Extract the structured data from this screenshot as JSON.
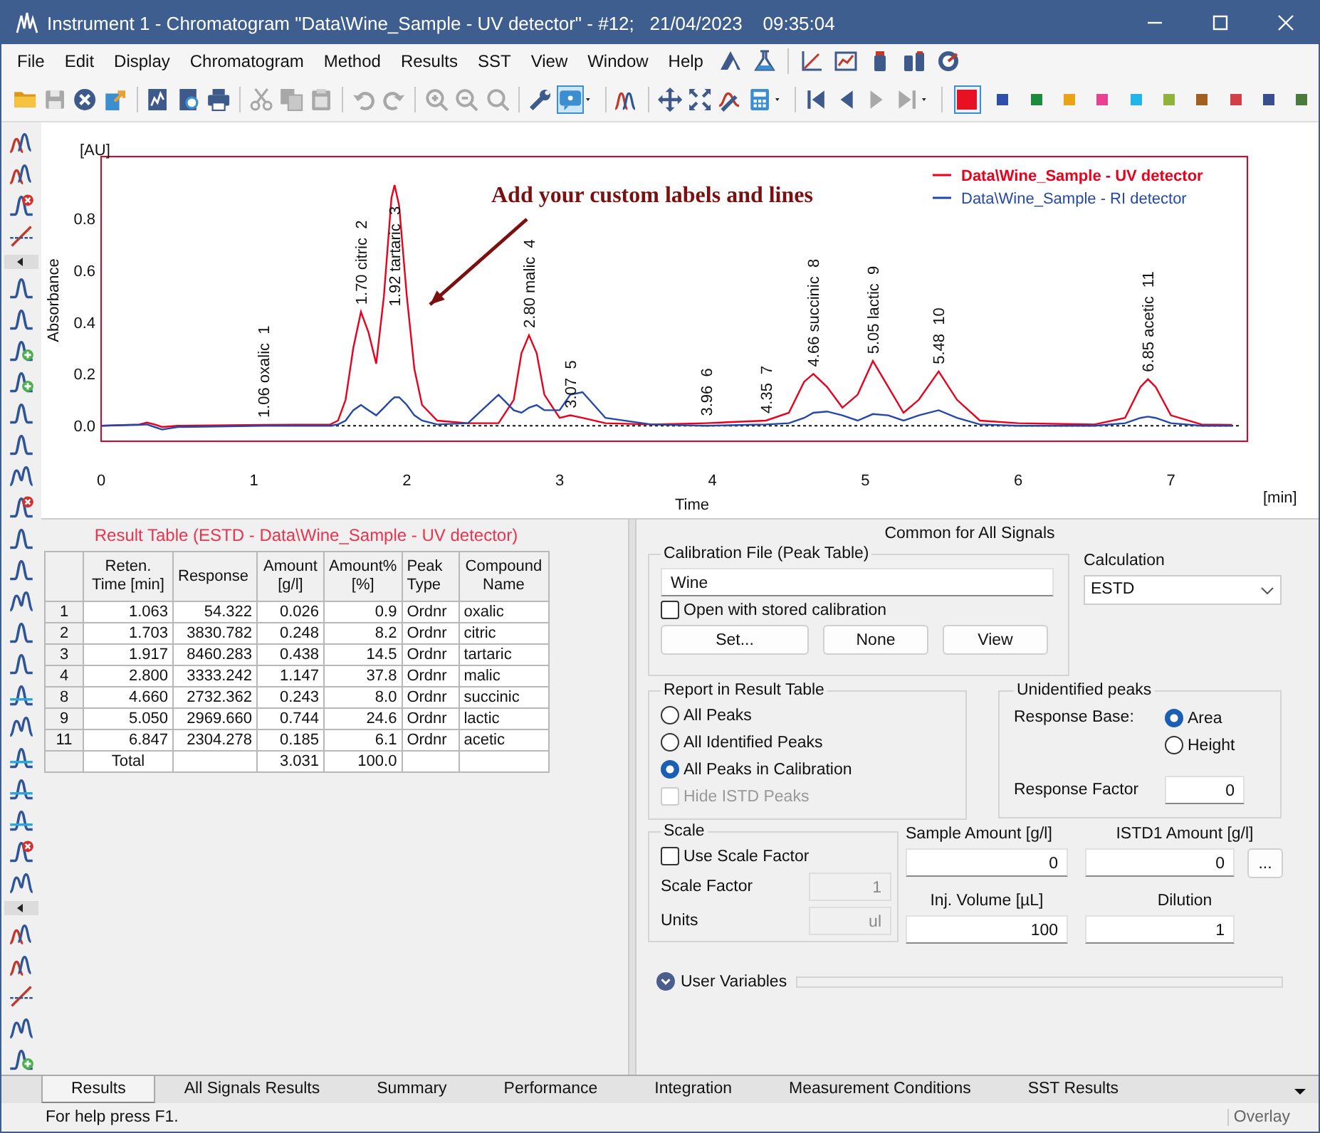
{
  "window": {
    "title": "Instrument 1 - Chromatogram \"Data\\Wine_Sample - UV detector\" - #12;   21/04/2023    09:35:04"
  },
  "menu": [
    "File",
    "Edit",
    "Display",
    "Chromatogram",
    "Method",
    "Results",
    "SST",
    "View",
    "Window",
    "Help"
  ],
  "toolbar": {
    "colors": [
      {
        "color": "#e81123",
        "selected": true
      },
      {
        "color": "#2f4fa8",
        "selected": false
      },
      {
        "color": "#1e8a3c",
        "selected": false
      },
      {
        "color": "#e8a317",
        "selected": false
      },
      {
        "color": "#e84393",
        "selected": false
      },
      {
        "color": "#22b5e8",
        "selected": false
      },
      {
        "color": "#8db33a",
        "selected": false
      },
      {
        "color": "#a0621e",
        "selected": false
      },
      {
        "color": "#d33f49",
        "selected": false
      },
      {
        "color": "#3b4f8c",
        "selected": false
      },
      {
        "color": "#4c7a3c",
        "selected": false
      }
    ]
  },
  "chart": {
    "x_unit": "[min]",
    "y_unit": "[AU]",
    "chart_data": {
      "type": "line",
      "xlabel": "Time",
      "ylabel": "Absorbance",
      "xlim": [
        0,
        7.5
      ],
      "ylim": [
        -0.06,
        1.04
      ],
      "legend": "upper right",
      "xticks": [
        0,
        1,
        2,
        3,
        4,
        5,
        6,
        7
      ],
      "yticks": [
        {
          "value": 0,
          "label": "0.0"
        },
        {
          "value": 0.2,
          "label": "0.2"
        },
        {
          "value": 0.4,
          "label": "0.4"
        },
        {
          "value": 0.6,
          "label": "0.6"
        },
        {
          "value": 0.8,
          "label": "0.8"
        }
      ],
      "x": [
        0,
        0.25,
        0.3,
        0.35,
        0.4,
        0.5,
        1.06,
        1.5,
        1.55,
        1.6,
        1.65,
        1.7,
        1.75,
        1.8,
        1.85,
        1.9,
        1.92,
        1.95,
        2.0,
        2.05,
        2.1,
        2.2,
        2.4,
        2.6,
        2.7,
        2.75,
        2.8,
        2.85,
        2.9,
        3.0,
        3.07,
        3.15,
        3.3,
        3.6,
        3.96,
        4.35,
        4.5,
        4.6,
        4.66,
        4.75,
        4.85,
        4.95,
        5.05,
        5.15,
        5.25,
        5.35,
        5.48,
        5.6,
        5.75,
        6.0,
        6.5,
        6.7,
        6.8,
        6.85,
        6.9,
        7.0,
        7.2,
        7.4
      ],
      "series": [
        {
          "name": "Data\\Wine_Sample - UV detector",
          "color": "#e8001c",
          "values": [
            0,
            0.005,
            0.012,
            0.005,
            -0.005,
            0,
            0.003,
            0.005,
            0.02,
            0.1,
            0.3,
            0.44,
            0.36,
            0.24,
            0.5,
            0.88,
            0.93,
            0.85,
            0.5,
            0.22,
            0.08,
            0.02,
            0.01,
            0.01,
            0.1,
            0.28,
            0.35,
            0.28,
            0.12,
            0.03,
            0.04,
            0.03,
            0.01,
            0.005,
            0.01,
            0.02,
            0.05,
            0.17,
            0.2,
            0.15,
            0.07,
            0.12,
            0.25,
            0.15,
            0.05,
            0.1,
            0.21,
            0.1,
            0.02,
            0.01,
            0.005,
            0.03,
            0.15,
            0.18,
            0.15,
            0.04,
            0.005,
            0.003
          ]
        },
        {
          "name": "Data\\Wine_Sample - RI detector",
          "color": "#2448a8",
          "values": [
            0,
            0.003,
            0.005,
            -0.005,
            -0.015,
            -0.005,
            0,
            0,
            0.005,
            0.02,
            0.06,
            0.08,
            0.06,
            0.04,
            0.07,
            0.1,
            0.11,
            0.11,
            0.08,
            0.04,
            0.02,
            0.005,
            0.01,
            0.12,
            0.06,
            0.05,
            0.07,
            0.08,
            0.06,
            0.06,
            0.12,
            0.13,
            0.03,
            0.005,
            0,
            0.005,
            0.01,
            0.03,
            0.05,
            0.055,
            0.04,
            0.02,
            0.045,
            0.04,
            0.02,
            0.04,
            0.06,
            0.03,
            0.005,
            0,
            0,
            0.01,
            0.03,
            0.035,
            0.03,
            0.01,
            0,
            0
          ]
        }
      ],
      "annotations": [
        {
          "x": 1.06,
          "y": 0.003,
          "text": "1.06 oxalic  1"
        },
        {
          "x": 1.7,
          "y": 0.44,
          "text": "1.70 citric  2"
        },
        {
          "x": 1.92,
          "y": 0.93,
          "text": "1.92 tartaric  3"
        },
        {
          "x": 2.8,
          "y": 0.35,
          "text": "2.80 malic  4"
        },
        {
          "x": 3.07,
          "y": 0.04,
          "text": "3.07  5"
        },
        {
          "x": 3.96,
          "y": 0.01,
          "text": "3.96  6"
        },
        {
          "x": 4.35,
          "y": 0.02,
          "text": "4.35  7"
        },
        {
          "x": 4.66,
          "y": 0.2,
          "text": "4.66 succinic  8"
        },
        {
          "x": 5.05,
          "y": 0.25,
          "text": "5.05 lactic  9"
        },
        {
          "x": 5.48,
          "y": 0.21,
          "text": "5.48  10"
        },
        {
          "x": 6.85,
          "y": 0.18,
          "text": "6.85 acetic  11"
        },
        "Add your custom labels and lines"
      ]
    }
  },
  "result_table": {
    "title": "Result Table (ESTD - Data\\Wine_Sample - UV detector)",
    "columns": [
      "",
      "Reten. Time [min]",
      "Response",
      "Amount [g/l]",
      "Amount% [%]",
      "Peak Type",
      "Compound Name"
    ],
    "rows": [
      [
        "1",
        "1.063",
        "54.322",
        "0.026",
        "0.9",
        "Ordnr",
        "oxalic"
      ],
      [
        "2",
        "1.703",
        "3830.782",
        "0.248",
        "8.2",
        "Ordnr",
        "citric"
      ],
      [
        "3",
        "1.917",
        "8460.283",
        "0.438",
        "14.5",
        "Ordnr",
        "tartaric"
      ],
      [
        "4",
        "2.800",
        "3333.242",
        "1.147",
        "37.8",
        "Ordnr",
        "malic"
      ],
      [
        "8",
        "4.660",
        "2732.362",
        "0.243",
        "8.0",
        "Ordnr",
        "succinic"
      ],
      [
        "9",
        "5.050",
        "2969.660",
        "0.744",
        "24.6",
        "Ordnr",
        "lactic"
      ],
      [
        "11",
        "6.847",
        "2304.278",
        "0.185",
        "6.1",
        "Ordnr",
        "acetic"
      ],
      [
        "",
        "Total",
        "",
        "3.031",
        "100.0",
        "",
        ""
      ]
    ]
  },
  "settings": {
    "heading": "Common for All Signals",
    "calibration": {
      "legend": "Calibration File (Peak Table)",
      "file": "Wine",
      "open_stored": {
        "label": "Open with stored calibration",
        "checked": false
      },
      "buttons": [
        "Set...",
        "None",
        "View"
      ]
    },
    "calculation": {
      "label": "Calculation",
      "value": "ESTD"
    },
    "report": {
      "legend": "Report in Result Table",
      "options": [
        {
          "label": "All Peaks",
          "selected": false
        },
        {
          "label": "All Identified Peaks",
          "selected": false
        },
        {
          "label": "All Peaks in Calibration",
          "selected": true
        }
      ],
      "hide_istd": {
        "label": "Hide ISTD Peaks",
        "checked": false,
        "disabled": true
      }
    },
    "unidentified": {
      "legend": "Unidentified peaks",
      "base_label": "Response Base:",
      "bases": [
        {
          "label": "Area",
          "selected": true
        },
        {
          "label": "Height",
          "selected": false
        }
      ],
      "factor_label": "Response Factor",
      "factor": "0"
    },
    "scale": {
      "legend": "Scale",
      "use": {
        "label": "Use Scale Factor",
        "checked": false
      },
      "fields_disabled": true,
      "factor_label": "Scale Factor",
      "factor": "1",
      "units_label": "Units",
      "units": "ul"
    },
    "amounts": [
      {
        "label": "Sample Amount [g/l]",
        "value": "0"
      },
      {
        "label": "ISTD1 Amount [g/l]",
        "value": "0",
        "button": "..."
      },
      {
        "label": "Inj. Volume [µL]",
        "value": "100"
      },
      {
        "label": "Dilution",
        "value": "1"
      }
    ],
    "user_variables": {
      "label": "User Variables",
      "expanded": false
    }
  },
  "tabs": [
    {
      "label": "Results",
      "selected": true
    },
    {
      "label": "All Signals Results",
      "selected": false
    },
    {
      "label": "Summary",
      "selected": false
    },
    {
      "label": "Performance",
      "selected": false
    },
    {
      "label": "Integration",
      "selected": false
    },
    {
      "label": "Measurement Conditions",
      "selected": false
    },
    {
      "label": "SST Results",
      "selected": false
    }
  ],
  "status_bar": {
    "help": "For help press F1.",
    "mode": "Overlay"
  }
}
